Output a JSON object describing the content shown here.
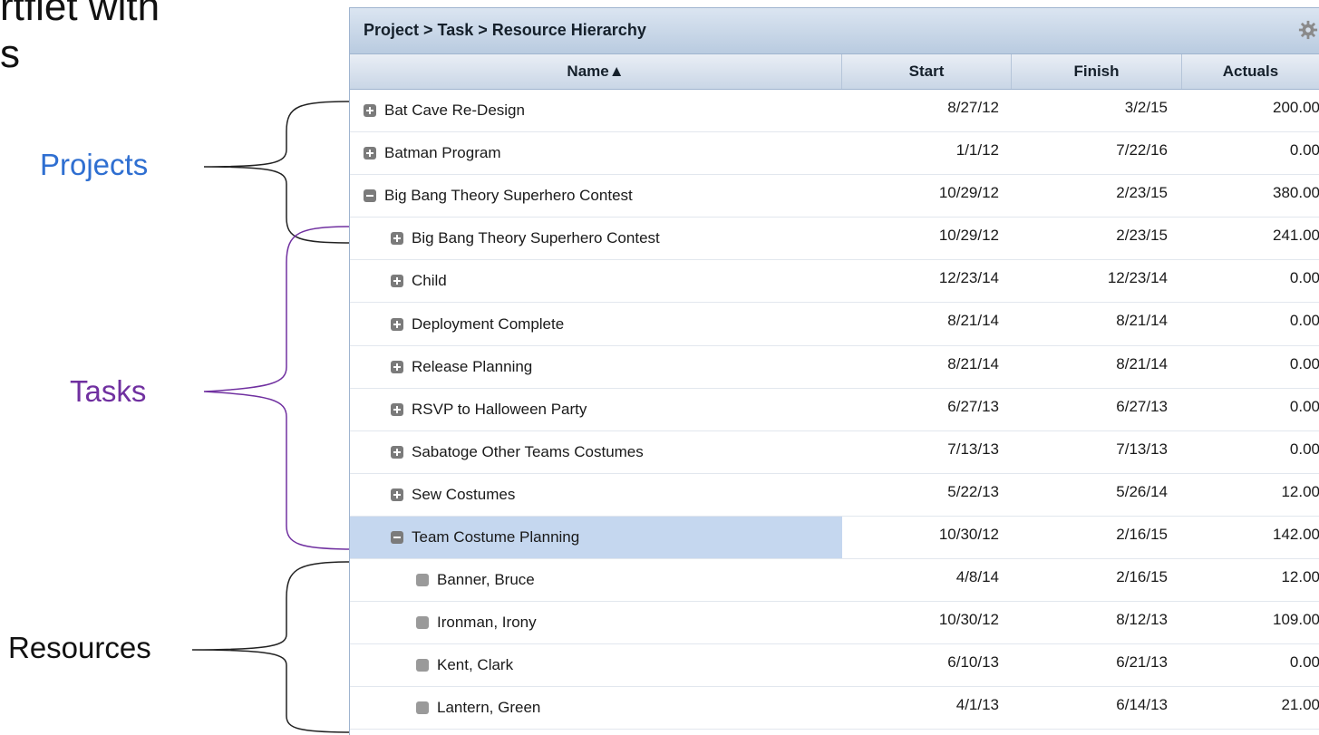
{
  "slide": {
    "title_line1": "rtfiet with",
    "title_line2": "s",
    "annotations": {
      "projects": "Projects",
      "tasks": "Tasks",
      "resources": "Resources"
    },
    "colors": {
      "projects": "#2f6fd1",
      "tasks": "#7030a0",
      "resources": "#111111"
    }
  },
  "grid": {
    "title": "Project > Task > Resource Hierarchy",
    "settings_icon": "gear-icon",
    "columns": {
      "name": "Name▲",
      "start": "Start",
      "finish": "Finish",
      "actuals": "Actuals"
    },
    "rows": [
      {
        "name": "Bat Cave Re-Design",
        "start": "8/27/12",
        "finish": "3/2/15",
        "actuals": "200.00",
        "level": 0,
        "expander": "plus"
      },
      {
        "name": "Batman Program",
        "start": "1/1/12",
        "finish": "7/22/16",
        "actuals": "0.00",
        "level": 0,
        "expander": "plus"
      },
      {
        "name": "Big Bang Theory Superhero Contest",
        "start": "10/29/12",
        "finish": "2/23/15",
        "actuals": "380.00",
        "level": 0,
        "expander": "minus"
      },
      {
        "name": "Big Bang Theory Superhero Contest",
        "start": "10/29/12",
        "finish": "2/23/15",
        "actuals": "241.00",
        "level": 1,
        "expander": "plus"
      },
      {
        "name": "Child",
        "start": "12/23/14",
        "finish": "12/23/14",
        "actuals": "0.00",
        "level": 1,
        "expander": "plus"
      },
      {
        "name": "Deployment Complete",
        "start": "8/21/14",
        "finish": "8/21/14",
        "actuals": "0.00",
        "level": 1,
        "expander": "plus"
      },
      {
        "name": "Release Planning",
        "start": "8/21/14",
        "finish": "8/21/14",
        "actuals": "0.00",
        "level": 1,
        "expander": "plus"
      },
      {
        "name": "RSVP to Halloween Party",
        "start": "6/27/13",
        "finish": "6/27/13",
        "actuals": "0.00",
        "level": 1,
        "expander": "plus"
      },
      {
        "name": "Sabatoge Other Teams Costumes",
        "start": "7/13/13",
        "finish": "7/13/13",
        "actuals": "0.00",
        "level": 1,
        "expander": "plus"
      },
      {
        "name": "Sew Costumes",
        "start": "5/22/13",
        "finish": "5/26/14",
        "actuals": "12.00",
        "level": 1,
        "expander": "plus"
      },
      {
        "name": "Team Costume Planning",
        "start": "10/30/12",
        "finish": "2/16/15",
        "actuals": "142.00",
        "level": 1,
        "expander": "minus",
        "selected": true
      },
      {
        "name": "Banner, Bruce",
        "start": "4/8/14",
        "finish": "2/16/15",
        "actuals": "12.00",
        "level": 2,
        "expander": "leaf"
      },
      {
        "name": "Ironman, Irony",
        "start": "10/30/12",
        "finish": "8/12/13",
        "actuals": "109.00",
        "level": 2,
        "expander": "leaf"
      },
      {
        "name": "Kent, Clark",
        "start": "6/10/13",
        "finish": "6/21/13",
        "actuals": "0.00",
        "level": 2,
        "expander": "leaf"
      },
      {
        "name": "Lantern, Green",
        "start": "4/1/13",
        "finish": "6/14/13",
        "actuals": "21.00",
        "level": 2,
        "expander": "leaf"
      }
    ]
  }
}
